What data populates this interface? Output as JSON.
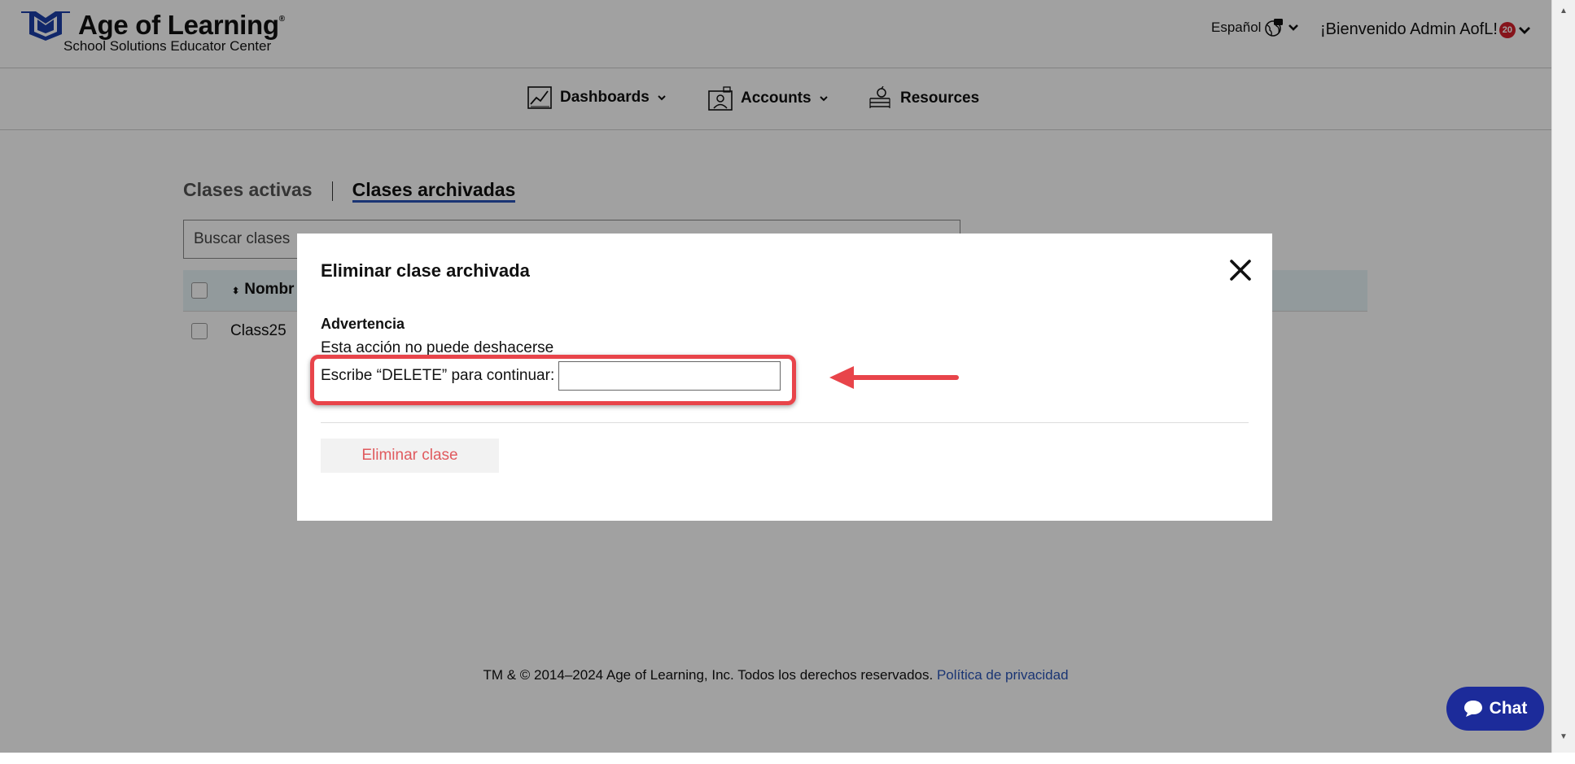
{
  "header": {
    "logo_title": "Age of Learning",
    "logo_tm": "®",
    "logo_subtitle": "School Solutions Educator Center",
    "language": "Español",
    "welcome": "¡Bienvenido Admin AofL!",
    "notification_count": "20"
  },
  "nav": {
    "items": [
      {
        "label": "Dashboards",
        "icon": "chart-line-icon",
        "has_dropdown": true
      },
      {
        "label": "Accounts",
        "icon": "user-id-icon",
        "has_dropdown": true
      },
      {
        "label": "Resources",
        "icon": "books-apple-icon",
        "has_dropdown": false
      }
    ]
  },
  "tabs": {
    "active": "Clases activas",
    "archived": "Clases archivadas"
  },
  "search": {
    "placeholder": "Buscar clases"
  },
  "table": {
    "column_name": "Nombr",
    "rows": [
      {
        "name": "Class25"
      }
    ]
  },
  "footer": {
    "copyright": "TM & © 2014–2024 Age of Learning, Inc. Todos los derechos reservados.",
    "privacy_link": "Política de privacidad"
  },
  "modal": {
    "title": "Eliminar clase archivada",
    "warning_title": "Advertencia",
    "warning_text": "Esta acción no puede deshacerse",
    "confirm_label": "Escribe “DELETE” para continuar:",
    "confirm_value": "",
    "delete_button": "Eliminar clase"
  },
  "chat": {
    "label": "Chat"
  },
  "colors": {
    "accent": "#2a55b8",
    "highlight": "#e8444a",
    "chat_bg": "#1c2b9a",
    "badge": "#d4202c"
  }
}
